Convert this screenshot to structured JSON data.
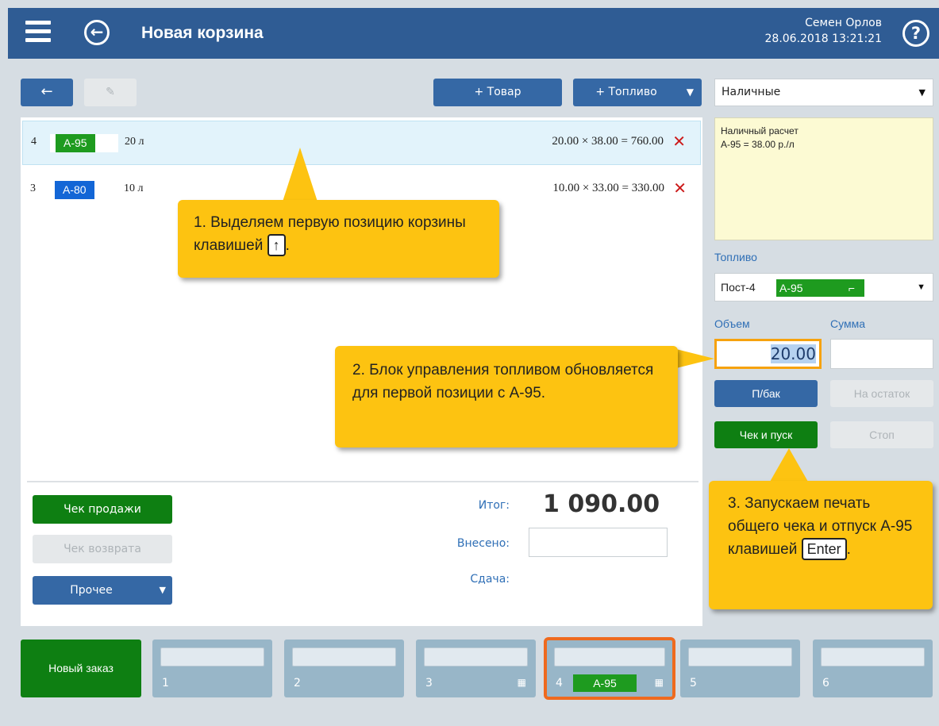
{
  "header": {
    "title": "Новая корзина",
    "user": "Семен Орлов",
    "datetime": "28.06.2018 13:21:21",
    "help": "?"
  },
  "toolbar": {
    "back": "←",
    "edit": "✎",
    "add_goods": "+ Товар",
    "add_fuel": "+ Топливо",
    "add_fuel_arrow": "▼"
  },
  "payment": {
    "selected": "Наличные",
    "arrow": "▼",
    "info_line1": "Наличный расчет",
    "info_line2": "А-95 = 38.00 р./л"
  },
  "cart_items": [
    {
      "num": "4",
      "fuel": "А-95",
      "color": "#1e9b1f",
      "volume": "20 л",
      "calc": "20.00 × 38.00 = 760.00",
      "remove": "✕"
    },
    {
      "num": "3",
      "fuel": "А-80",
      "color": "#1366d6",
      "volume": "10 л",
      "calc": "10.00 × 33.00 = 330.00",
      "remove": "✕"
    }
  ],
  "totals": {
    "total_label": "Итог:",
    "total_value": "1 090.00",
    "paid_label": "Внесено:",
    "change_label": "Сдача:"
  },
  "actions": {
    "sale_receipt": "Чек продажи",
    "return_receipt": "Чек возврата",
    "other": "Прочее",
    "other_arrow": "▼"
  },
  "fuel_control": {
    "section_label": "Топливо",
    "pump": "Пост-4",
    "pump_fuel": "А-95",
    "pump_arrow": "▼",
    "volume_label": "Объем",
    "sum_label": "Сумма",
    "volume_value": "20.00",
    "full_tank": "П/бак",
    "remainder": "На остаток",
    "receipt_start": "Чек и пуск",
    "stop": "Стоп"
  },
  "tips": {
    "tip1_text": "1. Выделяем первую позицию корзины клавишей",
    "tip1_key": "↑",
    "tip2_text": "2. Блок управления топливом обновляется для первой позиции с А-95.",
    "tip3_text": "3. Запускаем печать общего чека и отпуск А-95 клавишей",
    "tip3_key": "Enter"
  },
  "orders": {
    "new_order": "Новый заказ",
    "tabs": [
      {
        "num": "1"
      },
      {
        "num": "2"
      },
      {
        "num": "3",
        "basket": "🛒"
      },
      {
        "num": "4",
        "fuel": "А-95",
        "basket": "🛒"
      },
      {
        "num": "5"
      },
      {
        "num": "6"
      }
    ]
  },
  "colors": {
    "header": "#2f5c94",
    "primary": "#3568a5",
    "green": "#0e7f12",
    "tip": "#fdc311",
    "active_tab": "#ef6a1e"
  }
}
